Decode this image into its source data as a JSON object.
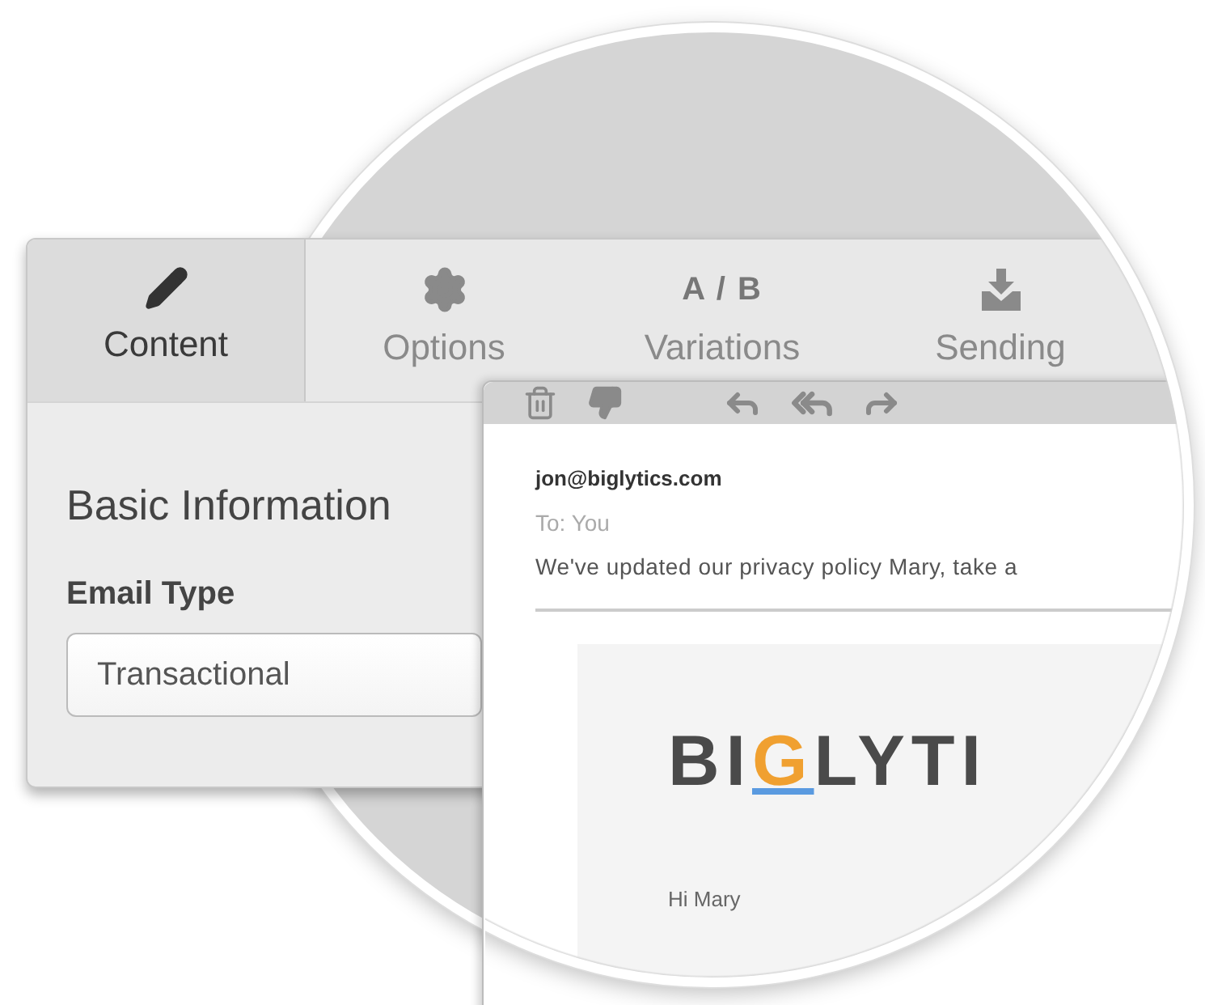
{
  "tabs": [
    {
      "label": "Content",
      "kind": "icon",
      "selected": true
    },
    {
      "label": "Options",
      "kind": "icon",
      "selected": false
    },
    {
      "label": "Variations",
      "kind": "text",
      "icon_text": "A / B",
      "selected": false
    },
    {
      "label": "Sending",
      "kind": "icon",
      "selected": false
    }
  ],
  "panel": {
    "title": "Basic Information",
    "field_label": "Email Type",
    "field_value": "Transactional"
  },
  "email": {
    "from": "jon@biglytics.com",
    "to": "To: You",
    "subject": "We've updated our privacy policy Mary, take a",
    "logo": {
      "before": "BI",
      "accent": "G",
      "after": "LYTI"
    },
    "greeting": "Hi Mary"
  }
}
